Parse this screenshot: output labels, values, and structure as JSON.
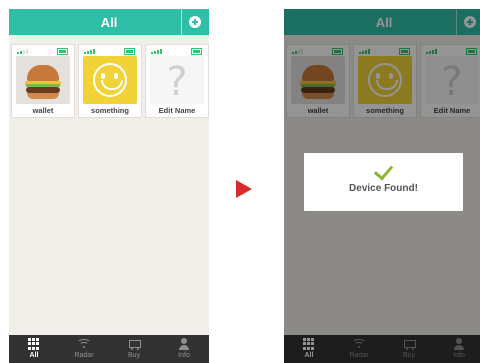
{
  "header": {
    "title": "All"
  },
  "devices": [
    {
      "name": "wallet",
      "signal": "weak",
      "image": "burger"
    },
    {
      "name": "something",
      "signal": "full",
      "image": "smiley"
    },
    {
      "name": "Edit Name",
      "signal": "full",
      "image": "question-mark"
    }
  ],
  "unknown_glyph": "?",
  "tabs": [
    {
      "label": "All",
      "icon": "grid-icon",
      "active": true
    },
    {
      "label": "Radar",
      "icon": "wifi-icon"
    },
    {
      "label": "Buy",
      "icon": "cart-icon"
    },
    {
      "label": "Info",
      "icon": "person-icon"
    }
  ],
  "dialog": {
    "message": "Device Found!"
  },
  "colors": {
    "header": "#2fbfa6",
    "tabbar": "#323232",
    "check": "#8ab834",
    "arrow": "#d82a2a"
  }
}
